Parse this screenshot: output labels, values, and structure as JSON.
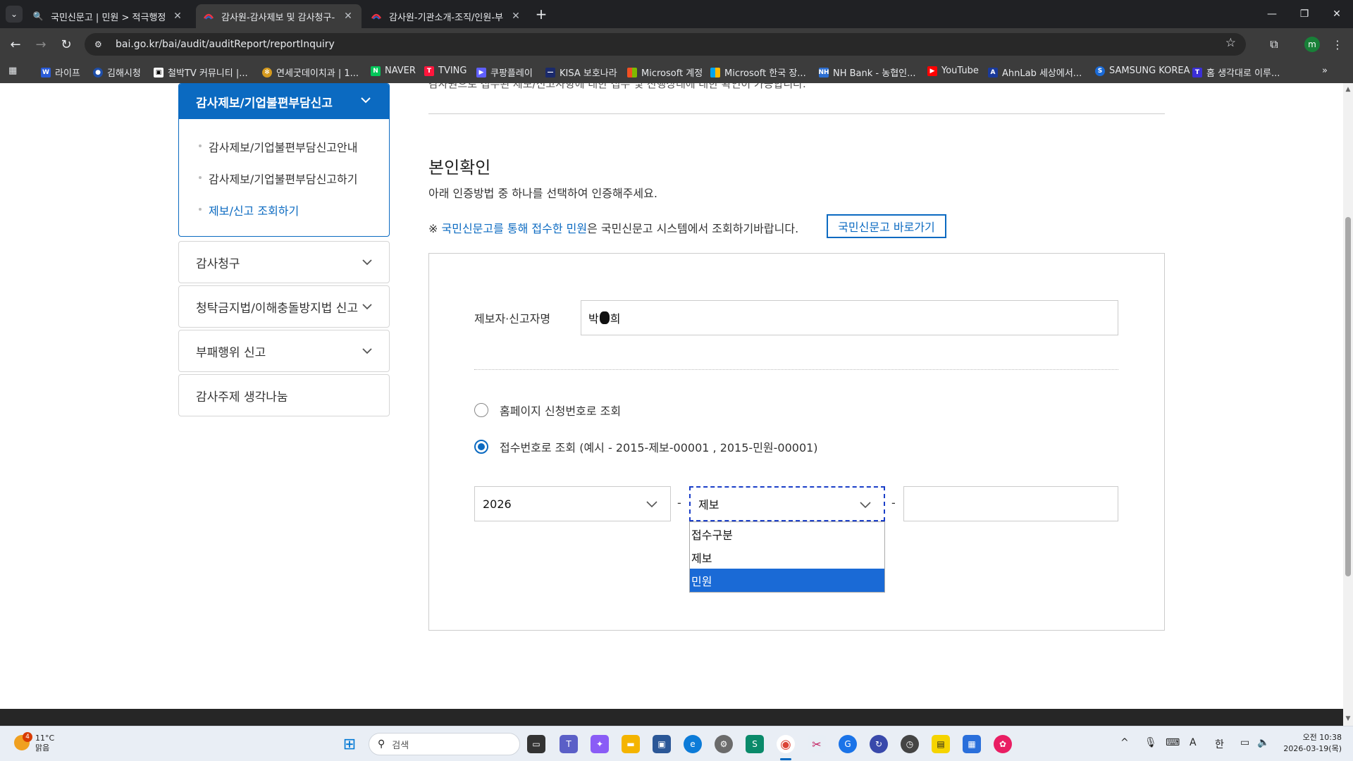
{
  "browser": {
    "tabs": [
      {
        "title": "국민신문고 | 민원 > 적극행정",
        "active": false
      },
      {
        "title": "감사원-감사제보 및 감사청구-",
        "active": true
      },
      {
        "title": "감사원-기관소개-조직/인원-부",
        "active": false
      }
    ],
    "url": "bai.go.kr/bai/audit/auditReport/reportInquiry",
    "profile_initial": "m",
    "bookmarks": [
      "라이프",
      "김해시청",
      "철박TV 커뮤니티 |...",
      "연세굿데이치과 | 1...",
      "NAVER",
      "TVING",
      "쿠팡플레이",
      "KISA 보호나라",
      "Microsoft 계정",
      "Microsoft 한국 장...",
      "NH Bank - 농협인...",
      "YouTube",
      "AhnLab 세상에서...",
      "SAMSUNG KOREA",
      "홈 생각대로 이루..."
    ]
  },
  "sidebar": {
    "active_section": "감사제보/기업불편부담신고",
    "sub_items": [
      "감사제보/기업불편부담신고안내",
      "감사제보/기업불편부담신고하기",
      "제보/신고 조회하기"
    ],
    "items": [
      "감사청구",
      "청탁금지법/이해충돌방지법 신고",
      "부패행위 신고",
      "감사주제 생각나눔"
    ]
  },
  "main": {
    "top_partial_text": "감사원으로 접수된 제보/신고사항에 대한 접수 및 진행상태에 대한 확인이 가능합니다.",
    "section_title": "본인확인",
    "section_desc": "아래 인증방법 중 하나를 선택하여 인증해주세요.",
    "note_prefix": "※ ",
    "note_link": "국민신문고를 통해 접수한 민원",
    "note_suffix": "은 국민신문고 시스템에서 조회하기바랍니다.",
    "shortcut_button": "국민신문고 바로가기",
    "name_label": "제보자·신고자명",
    "name_first": "박",
    "name_last": "희",
    "radio_homepage": "홈페이지 신청번호로 조회",
    "radio_receipt": "접수번호로 조회 (예시 - 2015-제보-00001 , 2015-민원-00001)",
    "year_value": "2026",
    "type_value": "제보",
    "number_value": "",
    "dropdown_options": [
      "접수구분",
      "제보",
      "민원"
    ],
    "separator": "-"
  },
  "taskbar": {
    "weather_badge": "4",
    "temperature": "11°C",
    "weather_desc": "맑음",
    "search_placeholder": "검색",
    "clock_time": "오전 10:38",
    "clock_date": "2026-03-19(목)",
    "ime_a": "A",
    "ime_han": "한"
  },
  "colors": {
    "accent": "#0b6ac1",
    "dropdown_highlight": "#1a6ad6"
  }
}
